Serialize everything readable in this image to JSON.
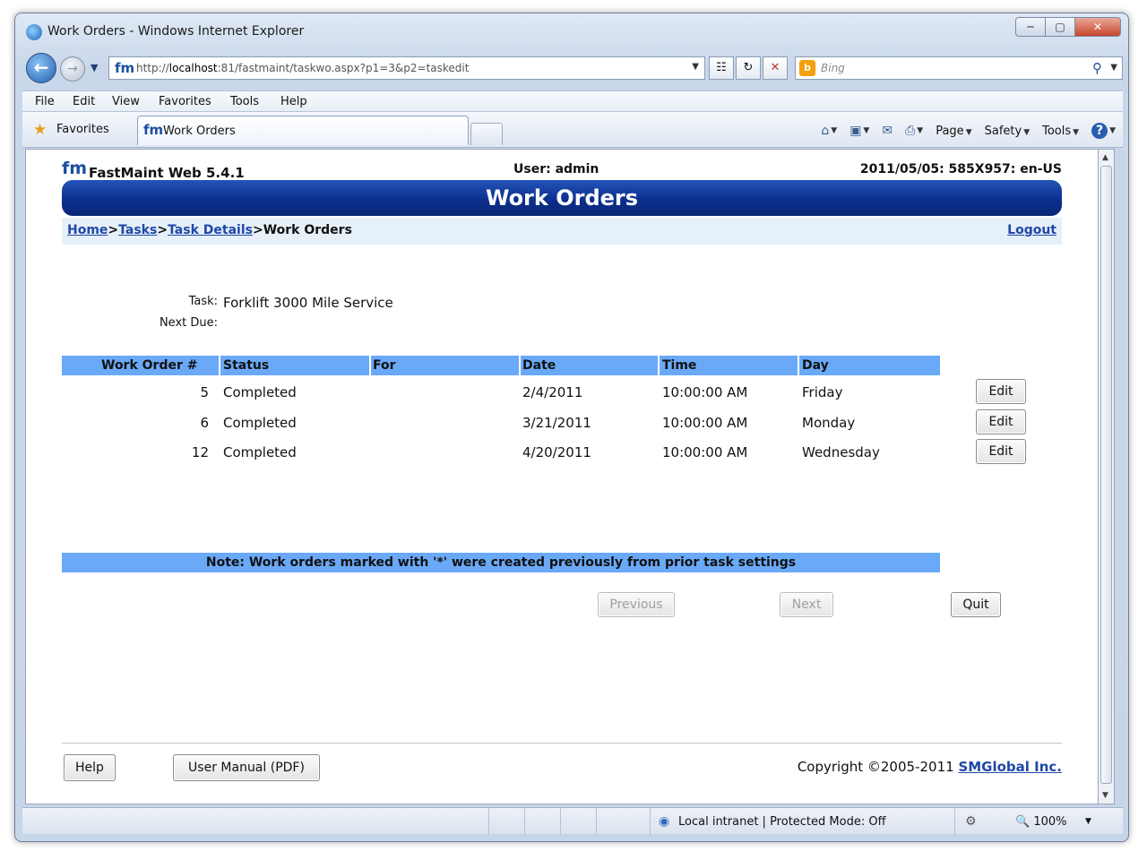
{
  "window": {
    "title": "Work Orders - Windows Internet Explorer",
    "controls": [
      "─",
      "▢",
      "✕"
    ]
  },
  "nav": {
    "url_prefix": "http://",
    "url_host": "localhost",
    "url_rest": ":81/fastmaint/taskwo.aspx?p1=3&p2=taskedit",
    "search_placeholder": "Bing"
  },
  "menu": [
    "File",
    "Edit",
    "View",
    "Favorites",
    "Tools",
    "Help"
  ],
  "favorites": {
    "label": "Favorites",
    "tab_label": "Work Orders"
  },
  "command_bar": {
    "page": "Page",
    "safety": "Safety",
    "tools": "Tools"
  },
  "app": {
    "name": "FastMaint Web 5.4.1",
    "user": "User: admin",
    "session": "2011/05/05: 585X957: en-US",
    "page_title": "Work Orders",
    "breadcrumb": {
      "home": "Home",
      "tasks": "Tasks",
      "task_details": "Task Details",
      "current": "Work Orders",
      "sep": ">"
    },
    "logout": "Logout"
  },
  "task": {
    "task_label": "Task:",
    "task_value": "Forklift 3000 Mile Service",
    "next_due_label": "Next Due:",
    "next_due_value": ""
  },
  "table": {
    "headers": [
      "Work Order #",
      "Status",
      "For",
      "Date",
      "Time",
      "Day"
    ],
    "rows": [
      {
        "number": "5",
        "status": "Completed",
        "for": "",
        "date": "2/4/2011",
        "time": "10:00:00 AM",
        "day": "Friday",
        "action": "Edit"
      },
      {
        "number": "6",
        "status": "Completed",
        "for": "",
        "date": "3/21/2011",
        "time": "10:00:00 AM",
        "day": "Monday",
        "action": "Edit"
      },
      {
        "number": "12",
        "status": "Completed",
        "for": "",
        "date": "4/20/2011",
        "time": "10:00:00 AM",
        "day": "Wednesday",
        "action": "Edit"
      }
    ]
  },
  "note": "Note: Work orders marked with '*' were created previously from prior task settings",
  "pager": {
    "previous": "Previous",
    "next": "Next",
    "quit": "Quit"
  },
  "footer": {
    "help": "Help",
    "manual": "User Manual (PDF)",
    "copyright": "Copyright ©2005-2011",
    "company": "SMGlobal Inc."
  },
  "status": {
    "zone": "Local intranet | Protected Mode: Off",
    "zoom": "100%"
  },
  "colors": {
    "banner": "#0c2f8e",
    "table_header": "#6aa9f8",
    "link": "#1f48a8",
    "breadcrumb_bg": "#e6f0f8"
  }
}
